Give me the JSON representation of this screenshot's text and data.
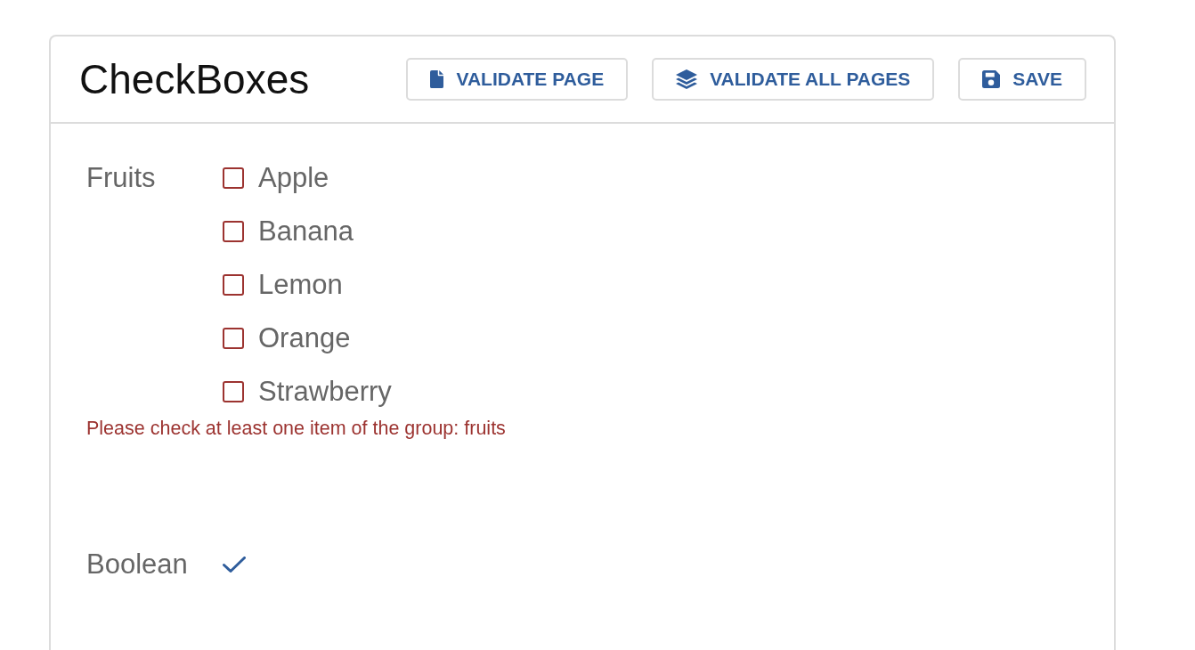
{
  "card": {
    "title": "CheckBoxes",
    "buttons": [
      {
        "label": "VALIDATE PAGE",
        "kind": "page"
      },
      {
        "label": "VALIDATE ALL PAGES",
        "kind": "pages"
      },
      {
        "label": "SAVE",
        "kind": "save"
      }
    ]
  },
  "fields": [
    {
      "kind": "group",
      "label": "Fruits",
      "options": [
        {
          "label": "Apple",
          "checked": false
        },
        {
          "label": "Banana",
          "checked": false
        },
        {
          "label": "Lemon",
          "checked": false
        },
        {
          "label": "Orange",
          "checked": false
        },
        {
          "label": "Strawberry",
          "checked": false
        }
      ],
      "error": "Please check at least one item of the group: fruits"
    },
    {
      "kind": "boolean",
      "label": "Boolean",
      "checked": true
    }
  ]
}
